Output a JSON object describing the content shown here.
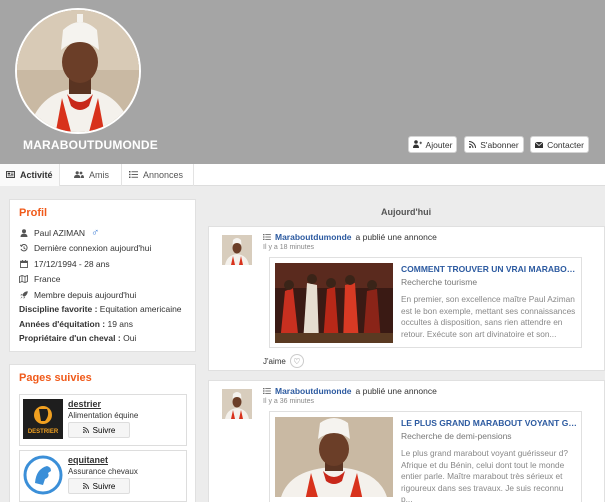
{
  "profile": {
    "username": "MARABOUTDUMONDE",
    "actions": {
      "add": "Ajouter",
      "subscribe": "S'abonner",
      "contact": "Contacter"
    }
  },
  "tabs": [
    {
      "label": "Activité",
      "icon": "newspaper-icon",
      "active": true
    },
    {
      "label": "Amis",
      "icon": "users-icon",
      "active": false
    },
    {
      "label": "Annonces",
      "icon": "list-icon",
      "active": false
    }
  ],
  "profile_card": {
    "title": "Profil",
    "name": "Paul AZIMAN",
    "gender_symbol": "♂",
    "last_login": "Dernière connexion aujourd'hui",
    "birth": "17/12/1994 - 28 ans",
    "country": "France",
    "member_since": "Membre depuis aujourd'hui",
    "discipline_label": "Discipline favorite :",
    "discipline_value": "Equitation americaine",
    "years_label": "Années d'équitation :",
    "years_value": "19 ans",
    "owner_label": "Propriétaire d'un cheval :",
    "owner_value": "Oui"
  },
  "pages_card": {
    "title": "Pages suivies",
    "items": [
      {
        "name": "destrier",
        "desc": "Alimentation équine",
        "follow": "Suivre",
        "logo_text": "DESTRIER"
      },
      {
        "name": "equitanet",
        "desc": "Assurance chevaux",
        "follow": "Suivre"
      }
    ]
  },
  "feed": {
    "day": "Aujourd'hui",
    "posts": [
      {
        "author": "Maraboutdumonde",
        "action": "a publié une annonce",
        "time": "Il y a 18 minutes",
        "title": "COMMENT TROUVER UN VRAI MARABOUT-VRAI M...",
        "subtitle": "Recherche tourisme",
        "text": "En premier, son excellence maître Paul Aziman est le bon exemple, mettant ses connaissances occultes à disposition, sans rien attendre en retour. Exécute son art divinatoire et son...",
        "like": "J'aime"
      },
      {
        "author": "Maraboutdumonde",
        "action": "a publié une annonce",
        "time": "Il y a 36 minutes",
        "title": "LE PLUS GRAND MARABOUT VOYANT GUÉRISSEU...",
        "subtitle": "Recherche de demi-pensions",
        "text": "Le plus grand marabout voyant guérisseur d? Afrique et du Bénin, celui dont tout le monde entier parle. Maître marabout très sérieux et rigoureux dans ses travaux. Je suis reconnu p..."
      }
    ]
  },
  "colors": {
    "accent": "#f05a1a",
    "link": "#2c5aa0",
    "cover": "#a5a5a5"
  }
}
